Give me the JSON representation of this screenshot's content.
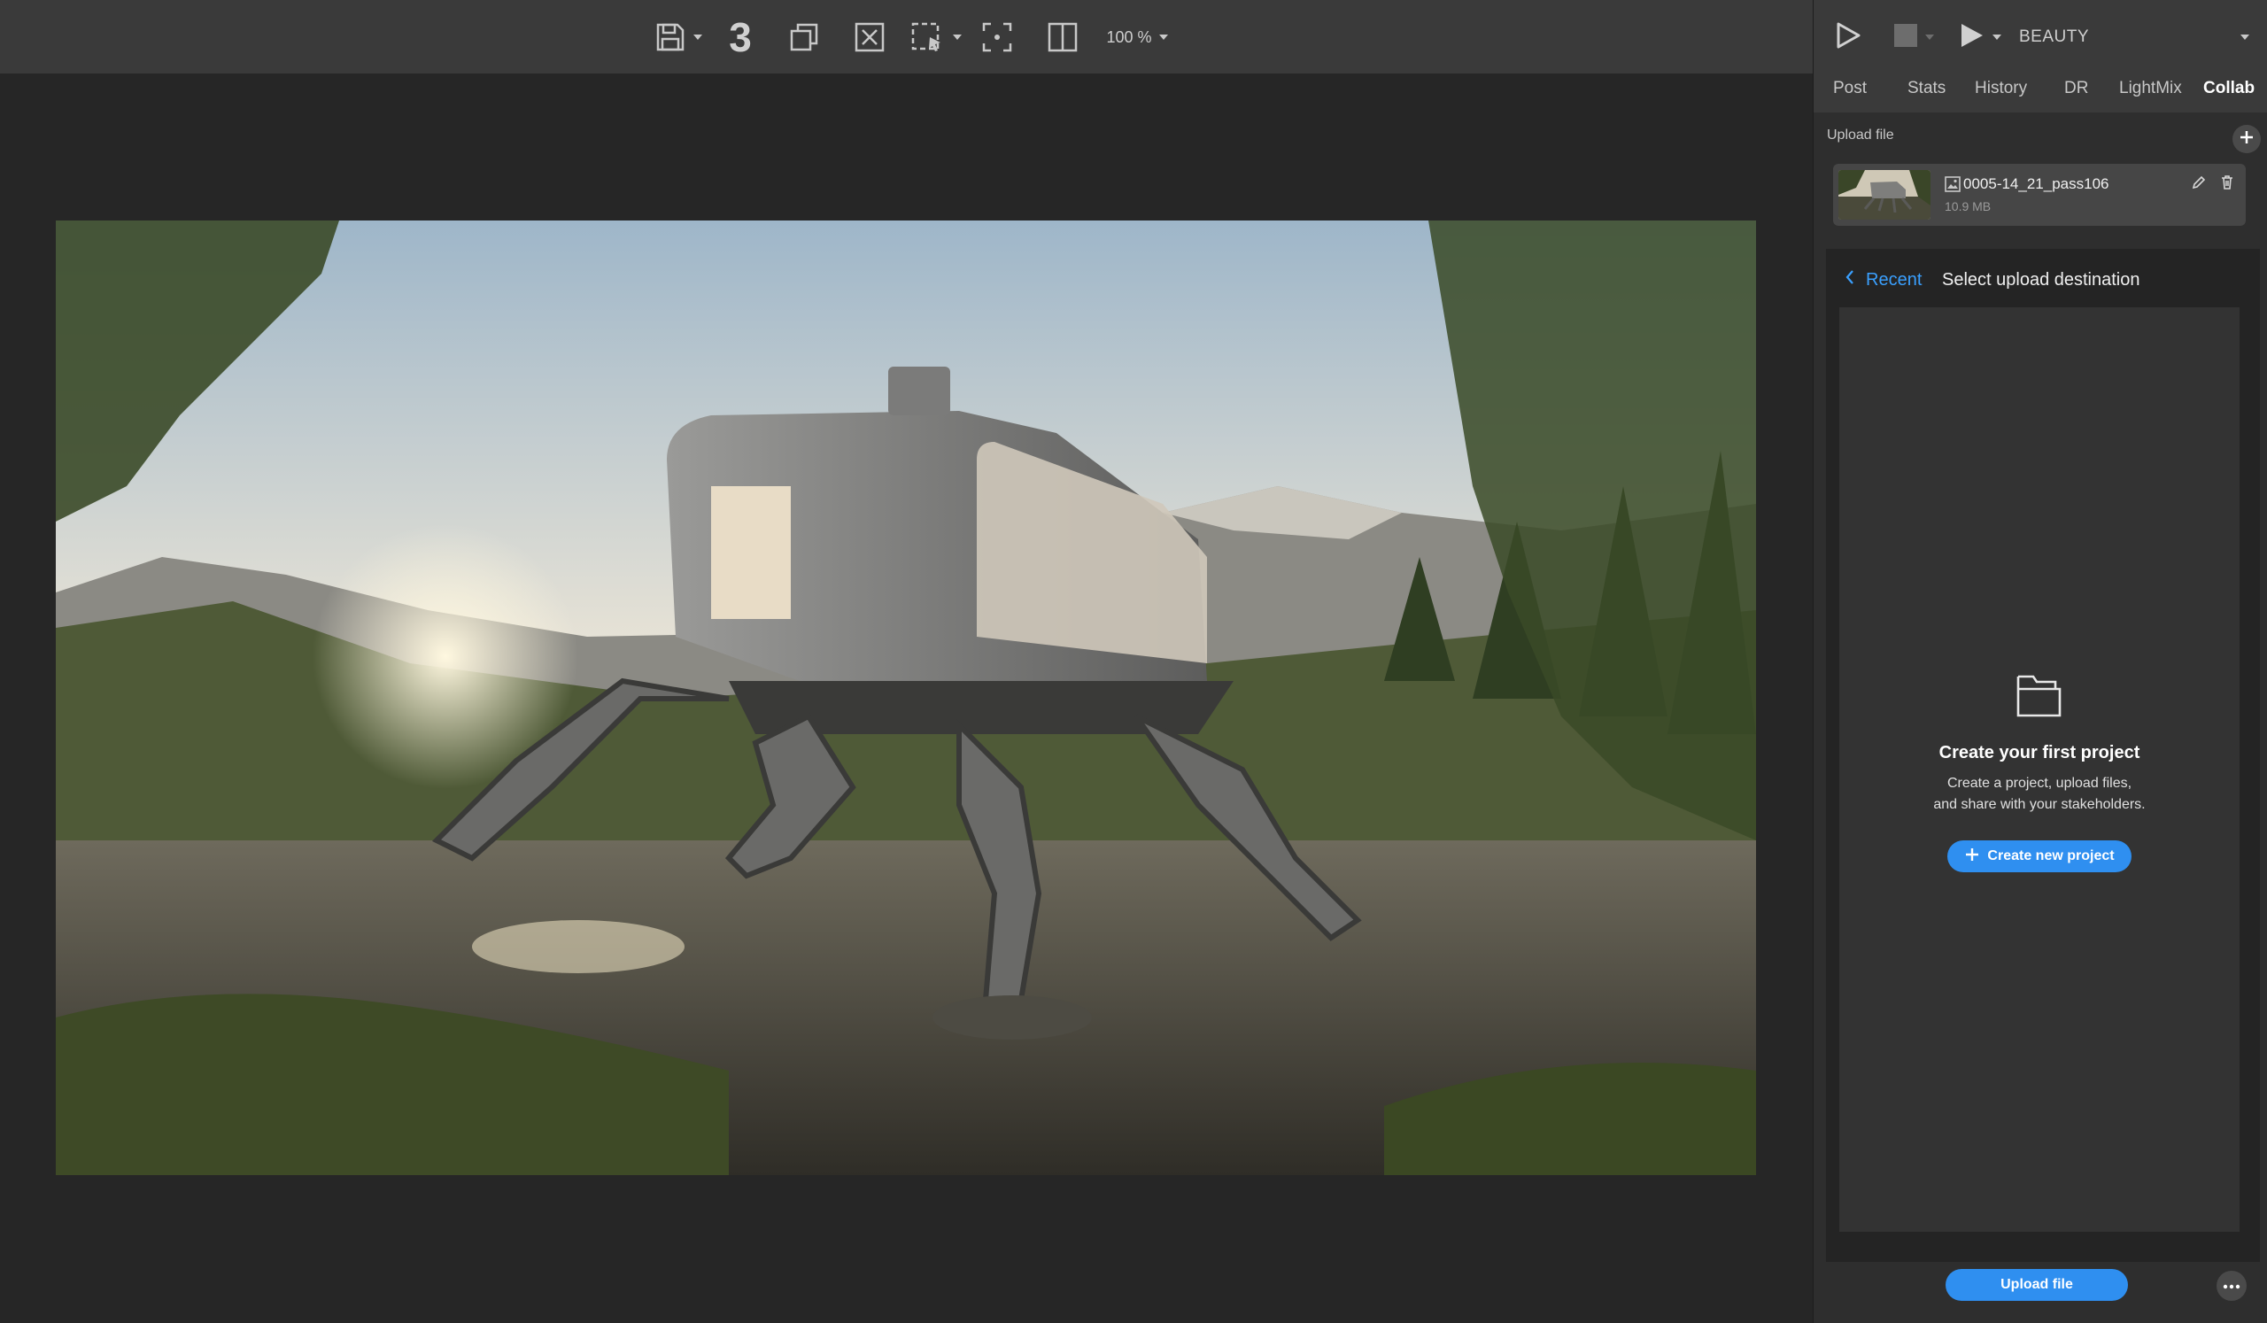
{
  "toolbar": {
    "render_count": "3",
    "zoom_label": "100 %"
  },
  "panel": {
    "render_channel": "BEAUTY",
    "tabs": [
      {
        "label": "Post",
        "active": false
      },
      {
        "label": "Stats",
        "active": false
      },
      {
        "label": "History",
        "active": false
      },
      {
        "label": "DR",
        "active": false
      },
      {
        "label": "LightMix",
        "active": false
      },
      {
        "label": "Collab",
        "active": true
      }
    ],
    "upload_section_label": "Upload file",
    "file": {
      "name": "0005-14_21_pass106",
      "size": "10.9 MB"
    },
    "destination": {
      "back_label": "Recent",
      "title": "Select upload destination",
      "empty_title": "Create your first project",
      "empty_desc_line1": "Create a project, upload files,",
      "empty_desc_line2": "and share with your stakeholders.",
      "create_button": "Create new project"
    },
    "footer": {
      "upload_button": "Upload file"
    }
  },
  "colors": {
    "accent": "#2f8ff0",
    "link": "#3aa0ff",
    "toolbar_bg": "#3a3a3a",
    "viewport_bg": "#262626"
  }
}
